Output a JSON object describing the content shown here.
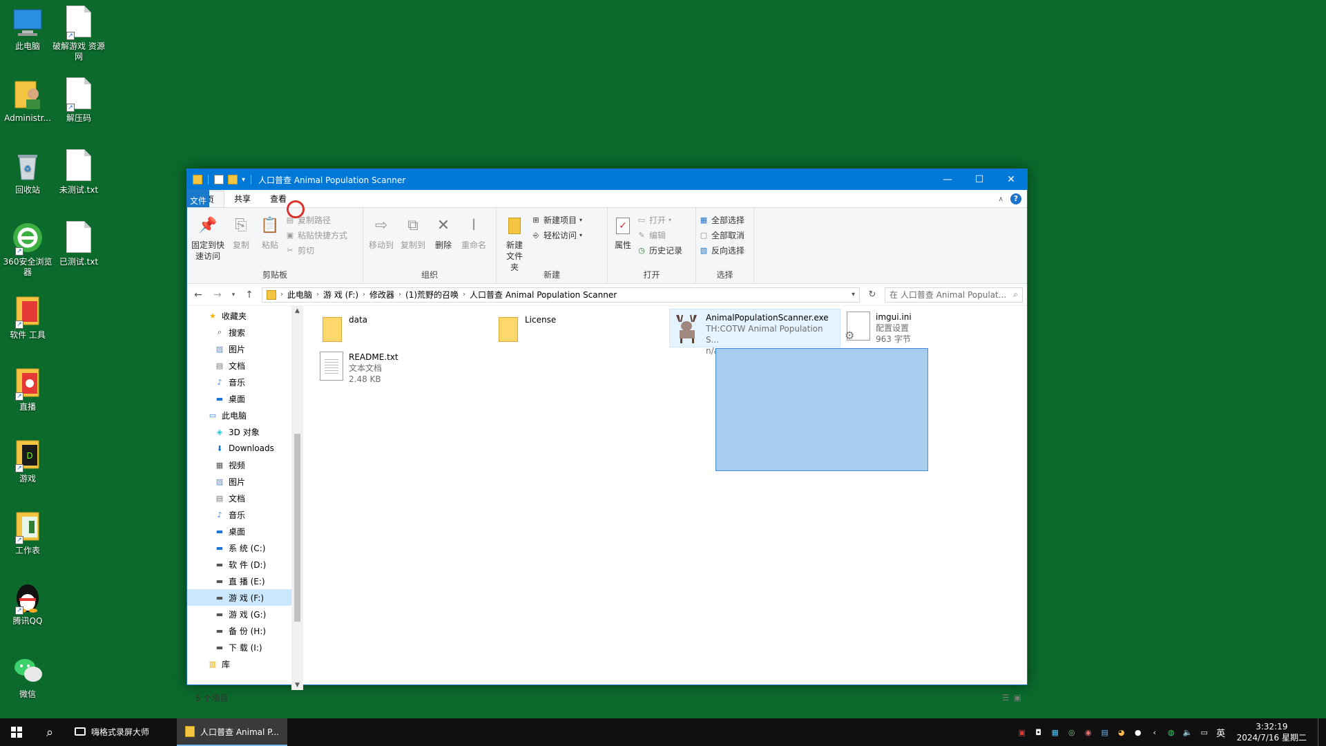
{
  "desktop": {
    "icons": [
      {
        "label": "此电脑",
        "icon": "computer-icon"
      },
      {
        "label": "破解游戏 资源网",
        "icon": "document-icon"
      },
      {
        "label": "Administr...",
        "icon": "user-folder-icon"
      },
      {
        "label": "解压码",
        "icon": "document-icon"
      },
      {
        "label": "回收站",
        "icon": "recycle-bin-icon"
      },
      {
        "label": "未测试.txt",
        "icon": "document-icon"
      },
      {
        "label": "360安全浏览器",
        "icon": "browser-360-icon"
      },
      {
        "label": "已测试.txt",
        "icon": "document-icon"
      },
      {
        "label": "软件 工具",
        "icon": "software-tools-icon"
      },
      {
        "label": "直播",
        "icon": "live-icon"
      },
      {
        "label": "游戏",
        "icon": "games-icon"
      },
      {
        "label": "工作表",
        "icon": "worksheet-icon"
      },
      {
        "label": "腾讯QQ",
        "icon": "qq-icon"
      },
      {
        "label": "微信",
        "icon": "wechat-icon"
      }
    ]
  },
  "window": {
    "title": "人口普查 Animal Population Scanner",
    "controls": {
      "minimize": "—",
      "maximize": "☐",
      "close": "✕"
    },
    "tabs": [
      "文件",
      "主页",
      "共享",
      "查看"
    ],
    "active_tab": "主页"
  },
  "ribbon": {
    "clipboard": {
      "label": "剪贴板",
      "pin": "固定到快速访问",
      "copy": "复制",
      "paste": "粘贴",
      "copy_path": "复制路径",
      "paste_shortcut": "粘贴快捷方式",
      "cut": "剪切"
    },
    "organize": {
      "label": "组织",
      "move_to": "移动到",
      "copy_to": "复制到",
      "delete": "删除",
      "rename": "重命名"
    },
    "new": {
      "label": "新建",
      "new_folder": "新建文件夹",
      "new_item": "新建项目",
      "easy_access": "轻松访问"
    },
    "open": {
      "label": "打开",
      "properties": "属性",
      "open": "打开",
      "edit": "编辑",
      "history": "历史记录"
    },
    "select": {
      "label": "选择",
      "select_all": "全部选择",
      "select_none": "全部取消",
      "invert": "反向选择"
    }
  },
  "address": {
    "crumbs": [
      "此电脑",
      "游 戏 (F:)",
      "修改器",
      "(1)荒野的召唤",
      "人口普查 Animal Population Scanner"
    ],
    "search_placeholder": "在 人口普查 Animal Populat..."
  },
  "navpane": {
    "items": [
      {
        "label": "收藏夹",
        "icon": "star-icon",
        "indent": 1
      },
      {
        "label": "搜索",
        "icon": "search-icon",
        "indent": 2
      },
      {
        "label": "图片",
        "icon": "pictures-icon",
        "indent": 2
      },
      {
        "label": "文档",
        "icon": "documents-icon",
        "indent": 2
      },
      {
        "label": "音乐",
        "icon": "music-icon",
        "indent": 2
      },
      {
        "label": "桌面",
        "icon": "desktop-icon",
        "indent": 2
      },
      {
        "label": "此电脑",
        "icon": "computer-icon",
        "indent": 1
      },
      {
        "label": "3D 对象",
        "icon": "3d-objects-icon",
        "indent": 2
      },
      {
        "label": "Downloads",
        "icon": "downloads-icon",
        "indent": 2
      },
      {
        "label": "视频",
        "icon": "videos-icon",
        "indent": 2
      },
      {
        "label": "图片",
        "icon": "pictures-icon",
        "indent": 2
      },
      {
        "label": "文档",
        "icon": "documents-icon",
        "indent": 2
      },
      {
        "label": "音乐",
        "icon": "music-icon",
        "indent": 2
      },
      {
        "label": "桌面",
        "icon": "desktop-icon",
        "indent": 2
      },
      {
        "label": "系 统 (C:)",
        "icon": "system-drive-icon",
        "indent": 2
      },
      {
        "label": "软 件 (D:)",
        "icon": "drive-icon",
        "indent": 2
      },
      {
        "label": "直 播 (E:)",
        "icon": "drive-icon",
        "indent": 2
      },
      {
        "label": "游 戏 (F:)",
        "icon": "drive-icon",
        "indent": 2,
        "selected": true
      },
      {
        "label": "游 戏 (G:)",
        "icon": "drive-icon",
        "indent": 2
      },
      {
        "label": "备 份 (H:)",
        "icon": "drive-icon",
        "indent": 2
      },
      {
        "label": "下 载 (I:)",
        "icon": "drive-icon",
        "indent": 2
      },
      {
        "label": "库",
        "icon": "library-icon",
        "indent": 1
      }
    ]
  },
  "files": [
    {
      "name": "data",
      "type": "folder"
    },
    {
      "name": "License",
      "type": "folder"
    },
    {
      "name": "AnimalPopulationScanner.exe",
      "line2": "TH:COTW Animal Population S...",
      "line3": "n/a",
      "type": "exe"
    },
    {
      "name": "imgui.ini",
      "line2": "配置设置",
      "line3": "963 字节",
      "type": "ini"
    },
    {
      "name": "README.txt",
      "line2": "文本文档",
      "line3": "2.48 KB",
      "type": "txt"
    }
  ],
  "status": {
    "count": "5 个项目"
  },
  "taskbar": {
    "tasks": [
      {
        "label": "嗨格式录屏大师",
        "icon": "screen-recorder-icon"
      },
      {
        "label": "人口普查 Animal P...",
        "icon": "folder-icon",
        "active": true
      }
    ],
    "ime": "英",
    "time": "3:32:19",
    "date": "2024/7/16 星期二"
  }
}
